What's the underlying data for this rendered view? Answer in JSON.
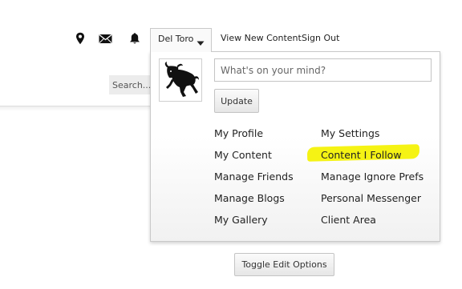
{
  "header": {
    "icons": [
      "map-pin-icon",
      "envelope-icon",
      "bell-icon"
    ],
    "user_name": "Del Toro",
    "view_new_content": "View New Content",
    "sign_out": "Sign Out",
    "search_placeholder": "Search..."
  },
  "dropdown": {
    "status_placeholder": "What's on your mind?",
    "update_label": "Update",
    "menu_left": [
      "My Profile",
      "My Content",
      "Manage Friends",
      "Manage Blogs",
      "My Gallery"
    ],
    "menu_right": [
      "My Settings",
      "Content I Follow",
      "Manage Ignore Prefs",
      "Personal Messenger",
      "Client Area"
    ],
    "highlight_color": "#f4f200"
  },
  "toggle_edit_label": "Toggle Edit Options"
}
